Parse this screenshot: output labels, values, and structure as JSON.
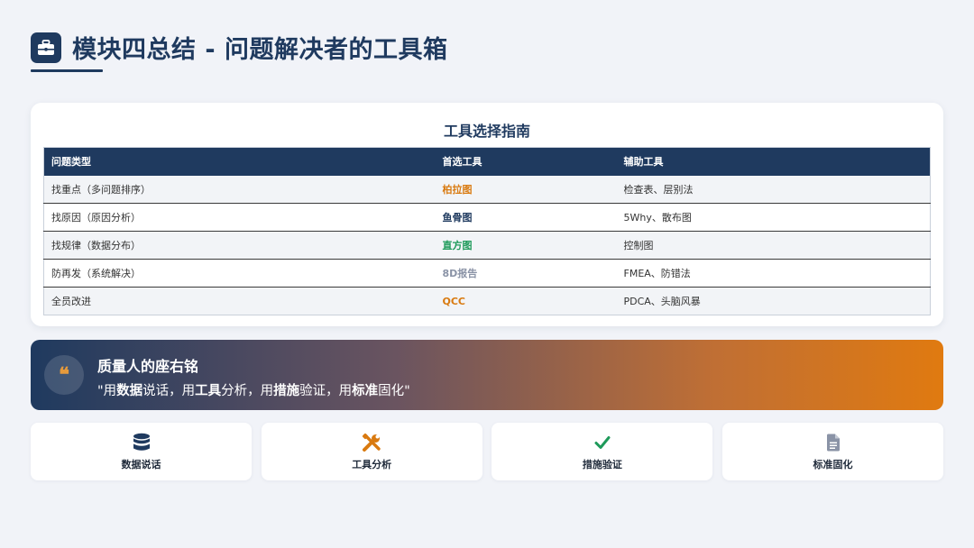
{
  "header": {
    "title": "模块四总结 - 问题解决者的工具箱",
    "icon": "toolbox-icon"
  },
  "guide": {
    "title": "工具选择指南",
    "columns": [
      "问题类型",
      "首选工具",
      "辅助工具"
    ],
    "rows": [
      {
        "type": "找重点（多问题排序）",
        "primary": "柏拉图",
        "primary_color": "#d97a10",
        "secondary": "检查表、层别法"
      },
      {
        "type": "找原因（原因分析）",
        "primary": "鱼骨图",
        "primary_color": "#1f3a5f",
        "secondary": "5Why、散布图"
      },
      {
        "type": "找规律（数据分布）",
        "primary": "直方图",
        "primary_color": "#1e9a5a",
        "secondary": "控制图"
      },
      {
        "type": "防再发（系统解决）",
        "primary": "8D报告",
        "primary_color": "#8a93a6",
        "secondary": "FMEA、防错法"
      },
      {
        "type": "全员改进",
        "primary": "QCC",
        "primary_color": "#d97a10",
        "secondary": "PDCA、头脑风暴"
      }
    ]
  },
  "motto": {
    "title": "质量人的座右铭",
    "quote_parts": [
      "\"用",
      "数据",
      "说话，用",
      "工具",
      "分析，用",
      "措施",
      "验证，用",
      "标准",
      "固化\""
    ],
    "icon": "quote-icon"
  },
  "cards": [
    {
      "label": "数据说话",
      "icon": "database-icon",
      "icon_color": "#1f3a5f"
    },
    {
      "label": "工具分析",
      "icon": "tools-icon",
      "icon_color": "#d97a10"
    },
    {
      "label": "措施验证",
      "icon": "check-icon",
      "icon_color": "#1e9a5a"
    },
    {
      "label": "标准固化",
      "icon": "document-icon",
      "icon_color": "#8a93a6"
    }
  ]
}
